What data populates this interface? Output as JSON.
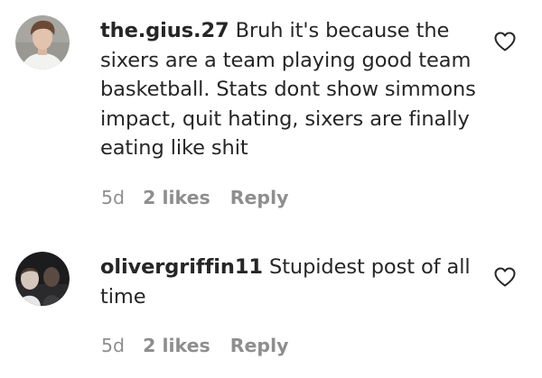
{
  "comments": [
    {
      "username": "the.gius.27",
      "text": "Bruh it's because the sixers are a team playing good team basketball. Stats dont show simmons impact, quit hating, sixers are finally eating like shit",
      "time": "5d",
      "likes": "2 likes",
      "reply_label": "Reply",
      "avatar_icon": "profile-photo",
      "like_icon": "heart-outline-icon"
    },
    {
      "username": "olivergriffin11",
      "text": "Stupidest post of all time",
      "time": "5d",
      "likes": "2 likes",
      "reply_label": "Reply",
      "avatar_icon": "profile-photo",
      "like_icon": "heart-outline-icon"
    }
  ],
  "colors": {
    "text": "#262626",
    "secondary": "#8e8e8e",
    "background": "#ffffff"
  }
}
